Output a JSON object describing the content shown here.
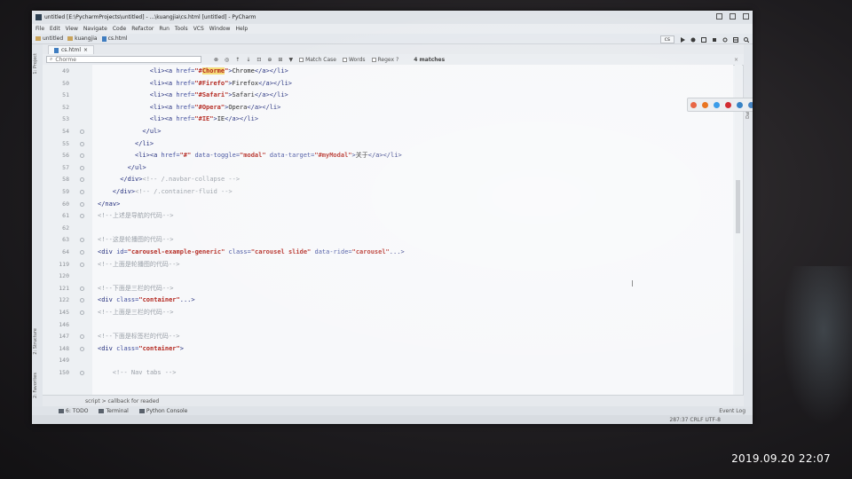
{
  "window": {
    "title": "untitled [E:\\PycharmProjects\\untitled] - ...\\kuangjia\\cs.html [untitled] - PyCharm"
  },
  "menu": [
    "File",
    "Edit",
    "View",
    "Navigate",
    "Code",
    "Refactor",
    "Run",
    "Tools",
    "VCS",
    "Window",
    "Help"
  ],
  "navbar": {
    "crumbs": [
      "untitled",
      "kuangjia",
      "cs.html"
    ],
    "run_config": "cs"
  },
  "left_tabs": [
    "1: Project",
    "2: Structure",
    "2: Favorites"
  ],
  "right_tabs": [
    "Database"
  ],
  "editor_tab": {
    "label": "cs.html"
  },
  "find": {
    "query": "Chorme",
    "match_case_label": "Match Case",
    "words_label": "Words",
    "regex_label": "Regex",
    "regex_help": "?",
    "result": "4 matches"
  },
  "code_lines": [
    {
      "num": "49",
      "indent": 14,
      "parts": [
        [
          "t",
          "<li><a "
        ],
        [
          "a",
          "href="
        ],
        [
          "s",
          "\"#"
        ],
        [
          "hl",
          "Chorme"
        ],
        [
          "s",
          "\""
        ],
        [
          "t",
          ">"
        ],
        [
          "x",
          "Chrome"
        ],
        [
          "t",
          "</a></li>"
        ]
      ]
    },
    {
      "num": "50",
      "indent": 14,
      "parts": [
        [
          "t",
          "<li><a "
        ],
        [
          "a",
          "href="
        ],
        [
          "s",
          "\"#Firefo\""
        ],
        [
          "t",
          ">"
        ],
        [
          "x",
          "Firefox"
        ],
        [
          "t",
          "</a></li>"
        ]
      ]
    },
    {
      "num": "51",
      "indent": 14,
      "parts": [
        [
          "t",
          "<li><a "
        ],
        [
          "a",
          "href="
        ],
        [
          "s",
          "\"#Safari\""
        ],
        [
          "t",
          ">"
        ],
        [
          "x",
          "Safari"
        ],
        [
          "t",
          "</a></li>"
        ]
      ]
    },
    {
      "num": "52",
      "indent": 14,
      "parts": [
        [
          "t",
          "<li><a "
        ],
        [
          "a",
          "href="
        ],
        [
          "s",
          "\"#Opera\""
        ],
        [
          "t",
          ">"
        ],
        [
          "x",
          "Opera"
        ],
        [
          "t",
          "</a></li>"
        ]
      ]
    },
    {
      "num": "53",
      "indent": 14,
      "parts": [
        [
          "t",
          "<li><a "
        ],
        [
          "a",
          "href="
        ],
        [
          "s",
          "\"#IE\""
        ],
        [
          "t",
          ">"
        ],
        [
          "x",
          "IE"
        ],
        [
          "t",
          "</a></li>"
        ]
      ]
    },
    {
      "num": "54",
      "indent": 12,
      "parts": [
        [
          "t",
          "</ul>"
        ]
      ]
    },
    {
      "num": "55",
      "indent": 10,
      "parts": [
        [
          "t",
          "</li>"
        ]
      ]
    },
    {
      "num": "56",
      "indent": 10,
      "parts": [
        [
          "t",
          "<li><a "
        ],
        [
          "a",
          "href="
        ],
        [
          "s",
          "\"#\""
        ],
        [
          "a",
          " data-toggle="
        ],
        [
          "s",
          "\"modal\""
        ],
        [
          "a",
          " data-target="
        ],
        [
          "s",
          "\"#myModal\""
        ],
        [
          "t",
          ">"
        ],
        [
          "x",
          "关于"
        ],
        [
          "t",
          "</a></li>"
        ]
      ]
    },
    {
      "num": "57",
      "indent": 8,
      "parts": [
        [
          "t",
          "</ul>"
        ]
      ]
    },
    {
      "num": "58",
      "indent": 6,
      "parts": [
        [
          "t",
          "</div>"
        ],
        [
          "c",
          "<!-- /.navbar-collapse -->"
        ]
      ]
    },
    {
      "num": "59",
      "indent": 4,
      "parts": [
        [
          "t",
          "</div>"
        ],
        [
          "c",
          "<!-- /.container-fluid -->"
        ]
      ]
    },
    {
      "num": "60",
      "indent": 0,
      "parts": [
        [
          "t",
          "</nav>"
        ]
      ]
    },
    {
      "num": "61",
      "indent": 0,
      "parts": [
        [
          "c",
          "<!--上述是导航的代码-->"
        ]
      ]
    },
    {
      "num": "62",
      "indent": 0,
      "parts": []
    },
    {
      "num": "63",
      "indent": 0,
      "parts": [
        [
          "c",
          "<!--这是轮播图的代码-->"
        ]
      ]
    },
    {
      "num": "64",
      "indent": 0,
      "parts": [
        [
          "t",
          "<div "
        ],
        [
          "a",
          "id="
        ],
        [
          "s",
          "\"carousel-example-generic\""
        ],
        [
          "a",
          " class="
        ],
        [
          "s",
          "\"carousel slide\""
        ],
        [
          "a",
          " data-ride="
        ],
        [
          "s",
          "\"carousel\""
        ],
        [
          "t",
          "..."
        ],
        [
          "t",
          ">"
        ]
      ]
    },
    {
      "num": "119",
      "indent": 0,
      "parts": [
        [
          "c",
          "<!--上面是轮播图的代码-->"
        ]
      ]
    },
    {
      "num": "120",
      "indent": 0,
      "parts": []
    },
    {
      "num": "121",
      "indent": 0,
      "parts": [
        [
          "c",
          "<!--下面是三栏的代码-->"
        ]
      ]
    },
    {
      "num": "122",
      "indent": 0,
      "parts": [
        [
          "t",
          "<div "
        ],
        [
          "a",
          "class="
        ],
        [
          "s",
          "\"container\""
        ],
        [
          "t",
          "..."
        ],
        [
          "t",
          ">"
        ]
      ]
    },
    {
      "num": "145",
      "indent": 0,
      "parts": [
        [
          "c",
          "<!--上面是三栏的代码-->"
        ]
      ]
    },
    {
      "num": "146",
      "indent": 0,
      "parts": []
    },
    {
      "num": "147",
      "indent": 0,
      "parts": [
        [
          "c",
          "<!--下面是标签栏的代码-->"
        ]
      ]
    },
    {
      "num": "148",
      "indent": 0,
      "parts": [
        [
          "t",
          "<div "
        ],
        [
          "a",
          "class="
        ],
        [
          "s",
          "\"container\""
        ],
        [
          "t",
          ">"
        ]
      ]
    },
    {
      "num": "149",
      "indent": 0,
      "parts": []
    },
    {
      "num": "150",
      "indent": 4,
      "parts": [
        [
          "c",
          "<!-- Nav tabs -->"
        ]
      ]
    }
  ],
  "breadcrumb_hint": "script > callback for readed",
  "bottom_tools": [
    "6: TODO",
    "Terminal",
    "Python Console"
  ],
  "event_log": "Event Log",
  "status": {
    "position": "287:37",
    "line_sep": "CRLF",
    "encoding": "UTF-8"
  },
  "timestamp": "2019.09.20 22:07",
  "colors": {
    "tag": "#1f2a7a",
    "attr": "#3c4a9b",
    "string": "#b3261e",
    "comment": "#9aa0a8",
    "search_highlight": "#f5dd7a"
  }
}
